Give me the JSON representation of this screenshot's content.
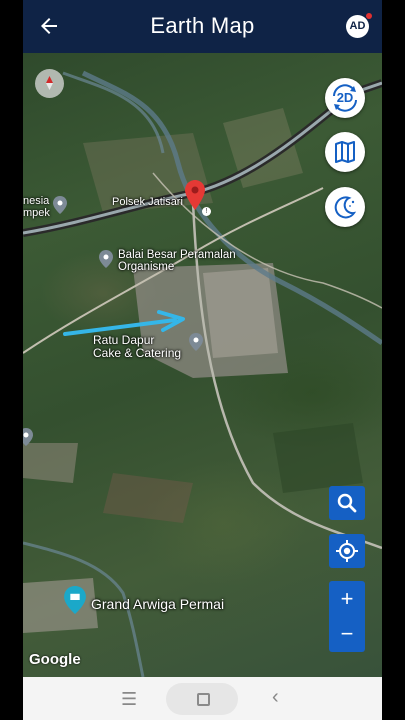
{
  "header": {
    "title": "Earth Map",
    "avatar_label": "AD"
  },
  "map": {
    "places": {
      "polsek": "Polsek Jatisari",
      "balai_line1": "Balai Besar Peramalan",
      "balai_line2": "Organisme",
      "ratu_line1": "Ratu Dapur",
      "ratu_line2": "Cake & Catering",
      "grand": "Grand Arwiga Permai",
      "left_line1": "nesia",
      "left_line2": "mpek"
    },
    "attribution": "Google"
  },
  "controls": {
    "view_mode_label": "2D",
    "zoom_in": "+",
    "zoom_out": "−"
  },
  "colors": {
    "header_bg": "#0f2346",
    "button_blue": "#1560c4",
    "pin_red": "#e53935",
    "arrow_cyan": "#35b6e8"
  },
  "icons": [
    "back-arrow-icon",
    "compass-icon",
    "layers-map-icon",
    "night-mode-icon",
    "search-icon",
    "my-location-icon",
    "menu-icon",
    "home-icon",
    "back-nav-icon"
  ]
}
